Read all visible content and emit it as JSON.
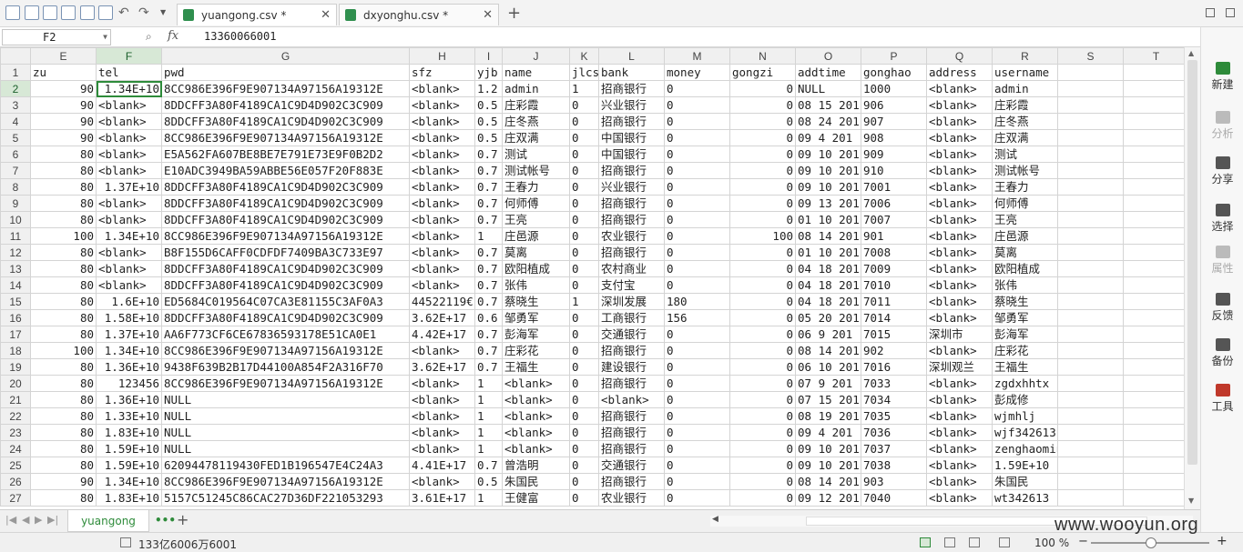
{
  "tabs": [
    {
      "label": "yuangong.csv *",
      "active": true
    },
    {
      "label": "dxyonghu.csv *",
      "active": false
    }
  ],
  "new_tab": "+",
  "formula": {
    "cell_ref": "F2",
    "fx": "fx",
    "value": "13360066001"
  },
  "columns": [
    "E",
    "F",
    "G",
    "H",
    "I",
    "J",
    "K",
    "L",
    "M",
    "N",
    "O",
    "P",
    "Q",
    "R",
    "S",
    "T"
  ],
  "rows": [
    [
      "1",
      "zu",
      "tel",
      "pwd",
      "sfz",
      "yjb",
      "name",
      "jlcs",
      "bank",
      "money",
      "gongzi",
      "addtime",
      "gonghao",
      "address",
      "username",
      "",
      ""
    ],
    [
      "2",
      "90",
      "1.34E+10",
      "8CC986E396F9E907134A97156A19312E",
      "<blank>",
      "1.2",
      "admin",
      "1",
      "招商银行",
      "0",
      "0",
      "NULL",
      "1000",
      "<blank>",
      "admin",
      "",
      ""
    ],
    [
      "3",
      "90",
      "<blank>",
      "8DDCFF3A80F4189CA1C9D4D902C3C909",
      "<blank>",
      "0.5",
      "庄彩霞",
      "0",
      "兴业银行",
      "0",
      "0",
      "08 15 201",
      "906",
      "<blank>",
      "庄彩霞",
      "",
      ""
    ],
    [
      "4",
      "90",
      "<blank>",
      "8DDCFF3A80F4189CA1C9D4D902C3C909",
      "<blank>",
      "0.5",
      "庄冬燕",
      "0",
      "招商银行",
      "0",
      "0",
      "08 24 201",
      "907",
      "<blank>",
      "庄冬燕",
      "",
      ""
    ],
    [
      "5",
      "90",
      "<blank>",
      "8CC986E396F9E907134A97156A19312E",
      "<blank>",
      "0.5",
      "庄双满",
      "0",
      "中国银行",
      "0",
      "0",
      "09  4 201",
      "908",
      "<blank>",
      "庄双满",
      "",
      ""
    ],
    [
      "6",
      "80",
      "<blank>",
      "E5A562FA607BE8BE7E791E73E9F0B2D2",
      "<blank>",
      "0.7",
      "测试",
      "0",
      "中国银行",
      "0",
      "0",
      "09 10 201",
      "909",
      "<blank>",
      "测试",
      "",
      ""
    ],
    [
      "7",
      "80",
      "<blank>",
      "E10ADC3949BA59ABBE56E057F20F883E",
      "<blank>",
      "0.7",
      "测试帐号",
      "0",
      "招商银行",
      "0",
      "0",
      "09 10 201",
      "910",
      "<blank>",
      "测试帐号",
      "",
      ""
    ],
    [
      "8",
      "80",
      "1.37E+10",
      "8DDCFF3A80F4189CA1C9D4D902C3C909",
      "<blank>",
      "0.7",
      "王春力",
      "0",
      "兴业银行",
      "0",
      "0",
      "09 10 201",
      "7001",
      "<blank>",
      "王春力",
      "",
      ""
    ],
    [
      "9",
      "80",
      "<blank>",
      "8DDCFF3A80F4189CA1C9D4D902C3C909",
      "<blank>",
      "0.7",
      "何师傅",
      "0",
      "招商银行",
      "0",
      "0",
      "09 13 201",
      "7006",
      "<blank>",
      "何师傅",
      "",
      ""
    ],
    [
      "10",
      "80",
      "<blank>",
      "8DDCFF3A80F4189CA1C9D4D902C3C909",
      "<blank>",
      "0.7",
      "王亮",
      "0",
      "招商银行",
      "0",
      "0",
      "01 10 201",
      "7007",
      "<blank>",
      "王亮",
      "",
      ""
    ],
    [
      "11",
      "100",
      "1.34E+10",
      "8CC986E396F9E907134A97156A19312E",
      "<blank>",
      "1",
      "庄邑源",
      "0",
      "农业银行",
      "0",
      "100",
      "08 14 201",
      "901",
      "<blank>",
      "庄邑源",
      "",
      ""
    ],
    [
      "12",
      "80",
      "<blank>",
      "B8F155D6CAFF0CDFDF7409BA3C733E97",
      "<blank>",
      "0.7",
      "莫离",
      "0",
      "招商银行",
      "0",
      "0",
      "01 10 201",
      "7008",
      "<blank>",
      "莫离",
      "",
      ""
    ],
    [
      "13",
      "80",
      "<blank>",
      "8DDCFF3A80F4189CA1C9D4D902C3C909",
      "<blank>",
      "0.7",
      "欧阳植成",
      "0",
      "农村商业",
      "0",
      "0",
      "04 18 201",
      "7009",
      "<blank>",
      "欧阳植成",
      "",
      ""
    ],
    [
      "14",
      "80",
      "<blank>",
      "8DDCFF3A80F4189CA1C9D4D902C3C909",
      "<blank>",
      "0.7",
      "张伟",
      "0",
      "支付宝",
      "0",
      "0",
      "04 18 201",
      "7010",
      "<blank>",
      "张伟",
      "",
      ""
    ],
    [
      "15",
      "80",
      "1.6E+10",
      "ED5684C019564C07CA3E81155C3AF0A3",
      "44522119€",
      "0.7",
      "蔡晓生",
      "1",
      "深圳发展",
      "180",
      "0",
      "04 18 201",
      "7011",
      "<blank>",
      "蔡晓生",
      "",
      ""
    ],
    [
      "16",
      "80",
      "1.58E+10",
      "8DDCFF3A80F4189CA1C9D4D902C3C909",
      "3.62E+17",
      "0.6",
      "邹勇军",
      "0",
      "工商银行",
      "156",
      "0",
      "05 20 201",
      "7014",
      "<blank>",
      "邹勇军",
      "",
      ""
    ],
    [
      "17",
      "80",
      "1.37E+10",
      "AA6F773CF6CE67836593178E51CA0E1",
      "4.42E+17",
      "0.7",
      "彭海军",
      "0",
      "交通银行",
      "0",
      "0",
      "06  9 201",
      "7015",
      "深圳市",
      "彭海军",
      "",
      ""
    ],
    [
      "18",
      "100",
      "1.34E+10",
      "8CC986E396F9E907134A97156A19312E",
      "<blank>",
      "0.7",
      "庄彩花",
      "0",
      "招商银行",
      "0",
      "0",
      "08 14 201",
      "902",
      "<blank>",
      "庄彩花",
      "",
      ""
    ],
    [
      "19",
      "80",
      "1.36E+10",
      "9438F639B2B17D44100A854F2A316F70",
      "3.62E+17",
      "0.7",
      "王福生",
      "0",
      "建设银行",
      "0",
      "0",
      "06 10 201",
      "7016",
      "深圳观兰",
      "王福生",
      "",
      ""
    ],
    [
      "20",
      "80",
      "123456",
      "8CC986E396F9E907134A97156A19312E",
      "<blank>",
      "1",
      "<blank>",
      "0",
      "招商银行",
      "0",
      "0",
      "07  9 201",
      "7033",
      "<blank>",
      "zgdxhhtx",
      "",
      ""
    ],
    [
      "21",
      "80",
      "1.36E+10",
      "NULL",
      "<blank>",
      "1",
      "<blank>",
      "0",
      "<blank>",
      "0",
      "0",
      "07 15 201",
      "7034",
      "<blank>",
      "彭成修",
      "",
      ""
    ],
    [
      "22",
      "80",
      "1.33E+10",
      "NULL",
      "<blank>",
      "1",
      "<blank>",
      "0",
      "招商银行",
      "0",
      "0",
      "08 19 201",
      "7035",
      "<blank>",
      "wjmhlj",
      "",
      ""
    ],
    [
      "23",
      "80",
      "1.83E+10",
      "NULL",
      "<blank>",
      "1",
      "<blank>",
      "0",
      "招商银行",
      "0",
      "0",
      "09  4 201",
      "7036",
      "<blank>",
      "wjf342613",
      "",
      ""
    ],
    [
      "24",
      "80",
      "1.59E+10",
      "NULL",
      "<blank>",
      "1",
      "<blank>",
      "0",
      "招商银行",
      "0",
      "0",
      "09 10 201",
      "7037",
      "<blank>",
      "zenghaoming",
      "",
      ""
    ],
    [
      "25",
      "80",
      "1.59E+10",
      "62094478119430FED1B196547E4C24A3",
      "4.41E+17",
      "0.7",
      "曾浩明",
      "0",
      "交通银行",
      "0",
      "0",
      "09 10 201",
      "7038",
      "<blank>",
      "1.59E+10",
      "",
      ""
    ],
    [
      "26",
      "90",
      "1.34E+10",
      "8CC986E396F9E907134A97156A19312E",
      "<blank>",
      "0.5",
      "朱国民",
      "0",
      "招商银行",
      "0",
      "0",
      "08 14 201",
      "903",
      "<blank>",
      "朱国民",
      "",
      ""
    ],
    [
      "27",
      "80",
      "1.83E+10",
      "5157C51245C86CAC27D36DF221053293",
      "3.61E+17",
      "1",
      "王健富",
      "0",
      "农业银行",
      "0",
      "0",
      "09 12 201",
      "7040",
      "<blank>",
      "wt342613",
      "",
      ""
    ]
  ],
  "sidebar": [
    {
      "label": "新建",
      "icon": "new-icon",
      "color": "#2e8b3a",
      "dim": false
    },
    {
      "label": "分析",
      "icon": "analyze-icon",
      "color": "#bbbbbb",
      "dim": true
    },
    {
      "label": "分享",
      "icon": "share-icon",
      "color": "#555555",
      "dim": false
    },
    {
      "label": "选择",
      "icon": "select-icon",
      "color": "#555555",
      "dim": false
    },
    {
      "label": "属性",
      "icon": "properties-icon",
      "color": "#bbbbbb",
      "dim": true
    },
    {
      "label": "反馈",
      "icon": "feedback-icon",
      "color": "#555555",
      "dim": false
    },
    {
      "label": "备份",
      "icon": "backup-icon",
      "color": "#555555",
      "dim": false
    },
    {
      "label": "工具",
      "icon": "tools-icon",
      "color": "#c0392b",
      "dim": false
    }
  ],
  "sheet": {
    "name": "yuangong",
    "add": "+",
    "more": "•••"
  },
  "status": {
    "sum": "133亿6006万6001",
    "zoom": "100 %",
    "zoom_minus": "−",
    "zoom_plus": "+"
  },
  "watermark": "www.wooyun.org",
  "colors": {
    "accent": "#2e8b3a",
    "header_bg": "#f0f0f0",
    "grid_line": "#d4d4d4"
  }
}
